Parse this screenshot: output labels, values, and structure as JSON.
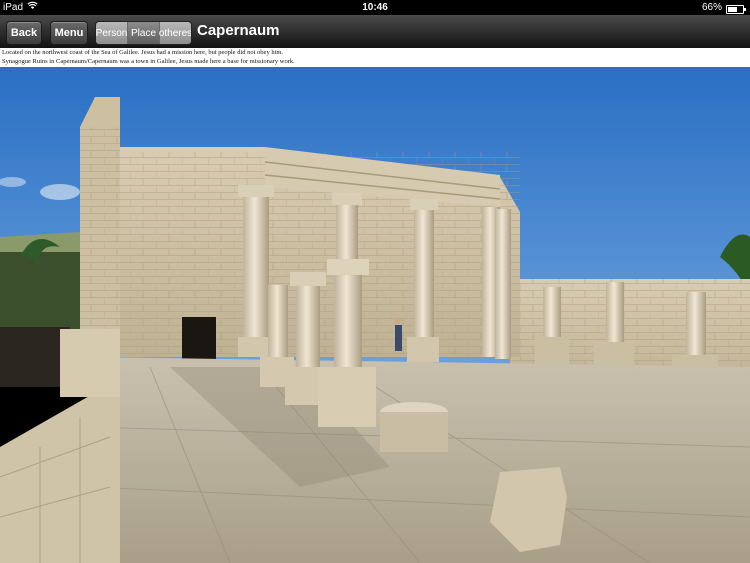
{
  "status": {
    "device": "iPad",
    "time": "10:46",
    "battery": "66%",
    "battery_level": 0.66
  },
  "nav": {
    "back": "Back",
    "menu": "Menu",
    "tabs": [
      "Person",
      "Place",
      "otheres"
    ],
    "selected_tab": "Place",
    "title": "Capernaum"
  },
  "description": {
    "line1": "Located on the northwest coast of the Sea of Galilee. Jesus had a mission here, but people did not obey him.",
    "line2": "Synagogue Ruins in Capernaum/Capernaum was a town in Galilee, Jesus made here a base for missionary work."
  },
  "colors": {
    "sky": "#2c72c7",
    "stone": "#c9bda3",
    "navbar": "#2a2a2a"
  }
}
